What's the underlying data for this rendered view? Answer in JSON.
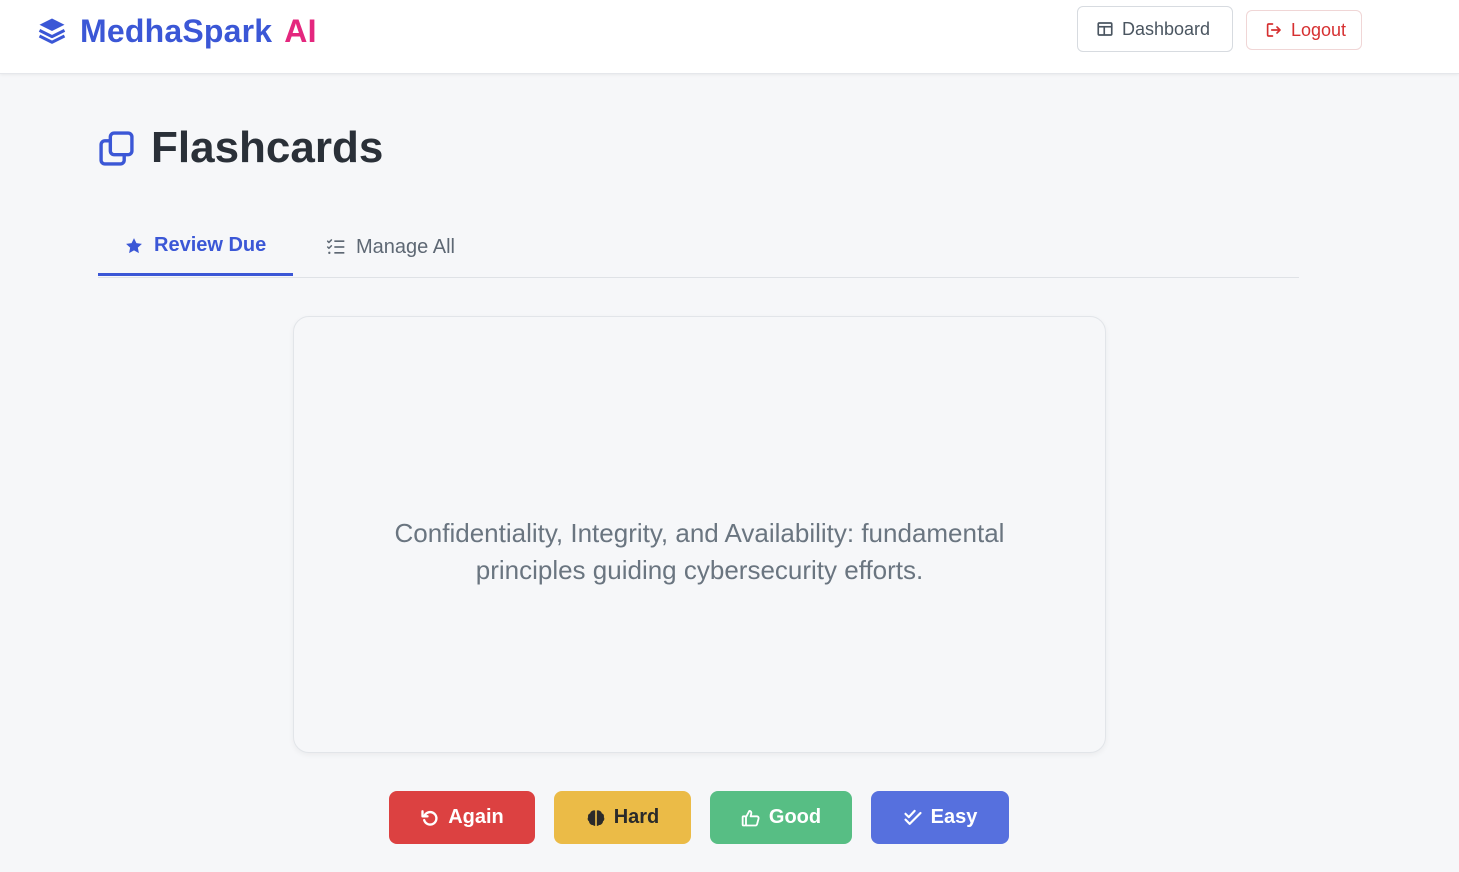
{
  "header": {
    "brand_name": "MedhaSpark",
    "brand_suffix": "AI",
    "brand_icon": "layers-icon",
    "dashboard_label": "Dashboard",
    "dashboard_icon": "layout-panel-icon",
    "logout_label": "Logout",
    "logout_icon": "sign-out-icon"
  },
  "page": {
    "title": "Flashcards",
    "title_icon": "copy-icon"
  },
  "tabs": [
    {
      "label": "Review Due",
      "icon": "star-icon",
      "active": true
    },
    {
      "label": "Manage All",
      "icon": "list-check-icon",
      "active": false
    }
  ],
  "card": {
    "text": "Confidentiality, Integrity, and Availability: fundamental principles guiding cybersecurity efforts."
  },
  "ratings": [
    {
      "label": "Again",
      "icon": "rotate-left-icon",
      "color": "#dc4141"
    },
    {
      "label": "Hard",
      "icon": "brain-icon",
      "color": "#ebbb47"
    },
    {
      "label": "Good",
      "icon": "thumbs-up-icon",
      "color": "#57be84"
    },
    {
      "label": "Easy",
      "icon": "check-double-icon",
      "color": "#5670de"
    }
  ],
  "colors": {
    "brand": "#3b57d6",
    "brand_accent": "#e4277e",
    "danger": "#d63031"
  }
}
